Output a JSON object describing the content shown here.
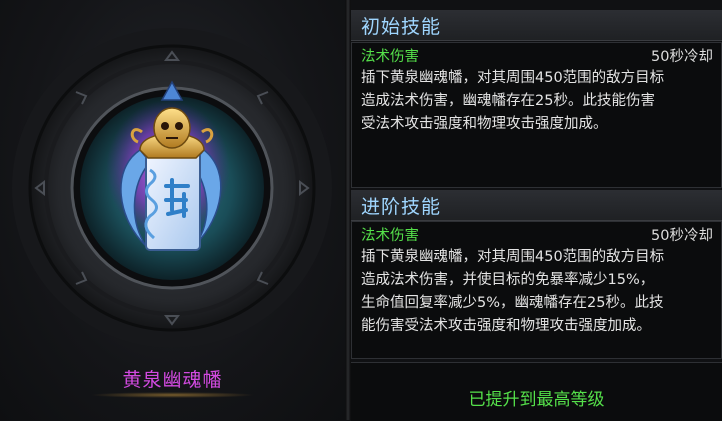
{
  "item": {
    "name": "黄泉幽魂幡",
    "icon": "soul-banner-icon"
  },
  "initial_skill": {
    "title": "初始技能",
    "type": "法术伤害",
    "cooldown": "50秒冷却",
    "description": "插下黄泉幽魂幡，对其周围450范围的敌方目标\n造成法术伤害，幽魂幡存在25秒。此技能伤害\n受法术攻击强度和物理攻击强度加成。"
  },
  "advanced_skill": {
    "title": "进阶技能",
    "type": "法术伤害",
    "cooldown": "50秒冷却",
    "description": "插下黄泉幽魂幡，对其周围450范围的敌方目标\n造成法术伤害，并使目标的免暴率减少15%，\n生命值回复率减少5%，幽魂幡存在25秒。此技\n能伤害受法术攻击强度和物理攻击强度加成。"
  },
  "status": {
    "max_level": "已提升到最高等级"
  },
  "colors": {
    "title": "#9fd6ff",
    "green": "#55e04a",
    "item_name": "#d24ae0"
  }
}
